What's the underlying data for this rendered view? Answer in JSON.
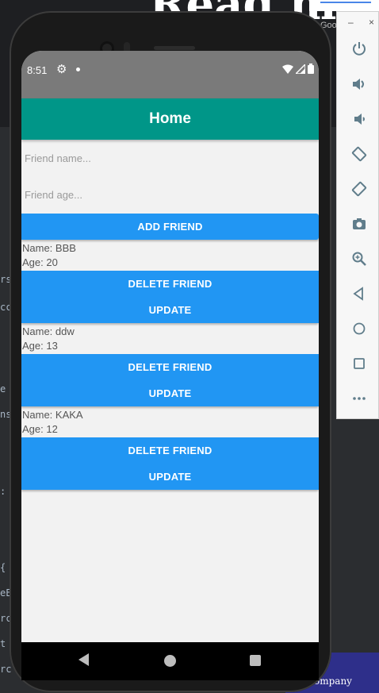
{
  "background": {
    "page_title_fragment": "Read m",
    "google_fragment": "Goo",
    "footer_fragment": "ompany",
    "code_fragments": [
      "rs",
      "cc",
      "e",
      "ns",
      ":",
      "{",
      "eE",
      "rc",
      "t",
      "rc"
    ]
  },
  "status_bar": {
    "time": "8:51"
  },
  "app": {
    "title": "Home",
    "name_placeholder": "Friend name...",
    "age_placeholder": "Friend age...",
    "add_button": "ADD FRIEND",
    "friends": [
      {
        "name": "Name: BBB",
        "age": "Age: 20",
        "delete": "DELETE FRIEND",
        "update": "UPDATE"
      },
      {
        "name": "Name: ddw",
        "age": "Age: 13",
        "delete": "DELETE FRIEND",
        "update": "UPDATE"
      },
      {
        "name": "Name: KAKA",
        "age": "Age: 12",
        "delete": "DELETE FRIEND",
        "update": "UPDATE"
      }
    ]
  },
  "colors": {
    "appbar": "#009688",
    "button": "#2196f3",
    "status_bar": "#7a7a7a"
  },
  "emulator_toolbar": {
    "minimize": "–",
    "close": "×",
    "buttons": [
      "power-icon",
      "volume-up-icon",
      "volume-down-icon",
      "rotate-left-icon",
      "rotate-right-icon",
      "camera-icon",
      "zoom-icon",
      "back-icon",
      "home-icon",
      "overview-icon",
      "more-icon"
    ]
  }
}
